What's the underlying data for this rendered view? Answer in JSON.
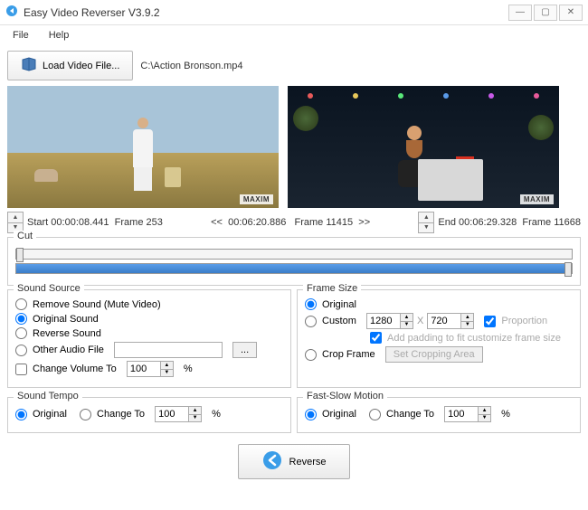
{
  "window": {
    "title": "Easy Video Reverser V3.9.2"
  },
  "menu": {
    "file": "File",
    "help": "Help"
  },
  "load": {
    "button": "Load Video File...",
    "path": "C:\\Action Bronson.mp4"
  },
  "watermark": "MAXIM",
  "timebar": {
    "start_label": "Start",
    "start_time": "00:00:08.441",
    "start_frame_label": "Frame",
    "start_frame": "253",
    "nav_prev": "<<",
    "cur_time": "00:06:20.886",
    "cur_frame_label": "Frame",
    "cur_frame": "11415",
    "nav_next": ">>",
    "end_label": "End",
    "end_time": "00:06:29.328",
    "end_frame_label": "Frame",
    "end_frame": "11668"
  },
  "cut": {
    "legend": "Cut"
  },
  "sound_source": {
    "legend": "Sound Source",
    "remove": "Remove Sound (Mute Video)",
    "original": "Original Sound",
    "reverse": "Reverse Sound",
    "other": "Other Audio File",
    "browse": "...",
    "change_volume": "Change Volume To",
    "volume_value": "100",
    "percent": "%"
  },
  "frame_size": {
    "legend": "Frame Size",
    "original": "Original",
    "custom": "Custom",
    "width": "1280",
    "x": "X",
    "height": "720",
    "proportion": "Proportion",
    "padding": "Add padding to fit customize frame size",
    "crop": "Crop Frame",
    "crop_btn": "Set Cropping Area"
  },
  "sound_tempo": {
    "legend": "Sound Tempo",
    "original": "Original",
    "change_to": "Change To",
    "value": "100",
    "percent": "%"
  },
  "fast_slow": {
    "legend": "Fast-Slow Motion",
    "original": "Original",
    "change_to": "Change To",
    "value": "100",
    "percent": "%"
  },
  "reverse_btn": "Reverse"
}
